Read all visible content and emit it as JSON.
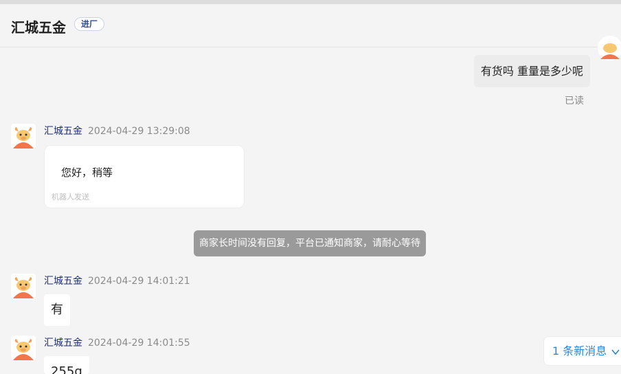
{
  "header": {
    "title": "汇城五金",
    "tag": "进厂"
  },
  "outgoing": {
    "text": "有货吗 重量是多少呢",
    "status": "已读"
  },
  "messages": [
    {
      "sender": "汇城五金",
      "time": "2024-04-29 13:29:08",
      "text": "您好，稍等",
      "note": "机器人发送"
    },
    {
      "sender": "汇城五金",
      "time": "2024-04-29 14:01:21",
      "text": "有"
    },
    {
      "sender": "汇城五金",
      "time": "2024-04-29 14:01:55",
      "text": "255g"
    }
  ],
  "system_notice": "商家长时间没有回复，平台已通知商家，请耐心等待",
  "new_message_button": {
    "label": "1 条新消息",
    "icon": "chevron-down-icon"
  },
  "colors": {
    "link": "#2a86d8",
    "sender": "#1d2e6e",
    "notice_bg": "#9a9a9a"
  }
}
